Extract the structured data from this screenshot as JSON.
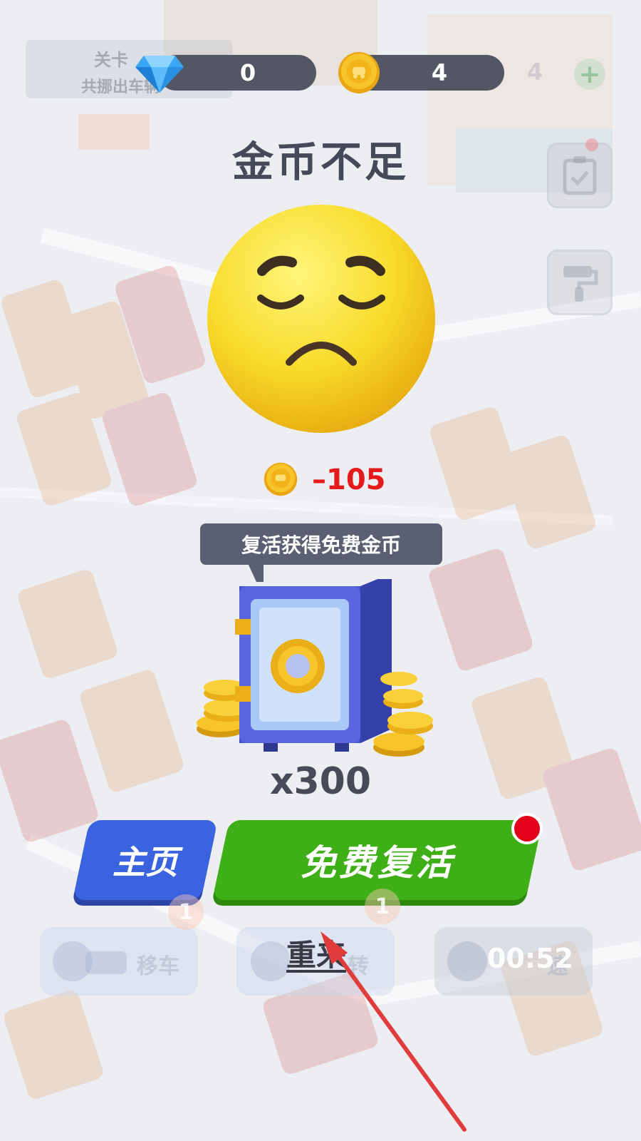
{
  "hud": {
    "level_title": "关卡",
    "level_subtitle": "共挪出车辆",
    "gems": "0",
    "coins": "4",
    "coins_ghost": "4",
    "plus": "+"
  },
  "dialog": {
    "title": "金币不足",
    "cost": "–105",
    "tooltip": "复活获得免费金币",
    "reward": "x300"
  },
  "buttons": {
    "home": "主页",
    "revive": "免费复活",
    "retry": "重来"
  },
  "tools": {
    "move_car": "移车",
    "move_car_badge": "1",
    "rotate": "转",
    "rotate_badge": "1",
    "speed": "速",
    "timer": "00:52"
  },
  "colors": {
    "revive_green": "#3faf17",
    "home_blue": "#3b63df",
    "cost_red": "#e51a1a",
    "alert_red": "#e5001a",
    "hud_pill": "#525763"
  }
}
